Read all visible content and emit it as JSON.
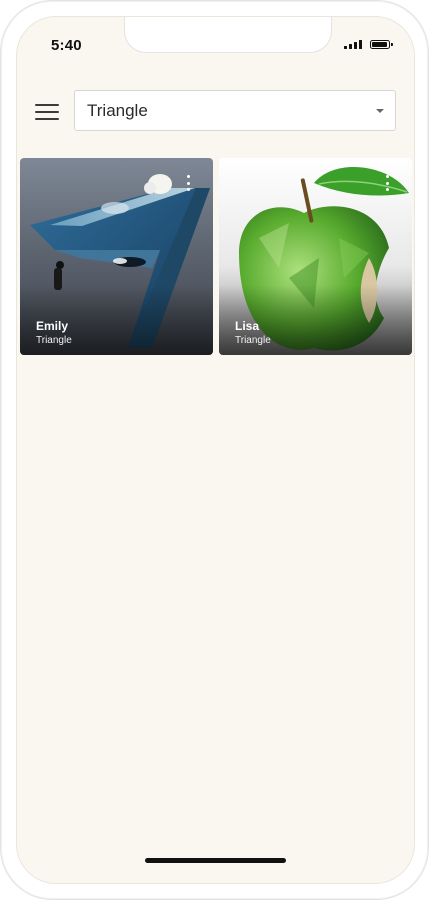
{
  "status_bar": {
    "time": "5:40",
    "icons": [
      "signal-icon",
      "battery-icon"
    ]
  },
  "header": {
    "menu_icon": "hamburger-menu-icon",
    "dropdown": {
      "value": "Triangle",
      "icon": "caret-down-icon"
    }
  },
  "cards": [
    {
      "title": "Emily",
      "subtitle": "Triangle",
      "more_icon": "more-vertical-icon"
    },
    {
      "title": "Lisa",
      "subtitle": "Triangle",
      "more_icon": "more-vertical-icon"
    }
  ],
  "colors": {
    "screen_background": "#f9f7f0",
    "card_text": "#ffffff"
  }
}
